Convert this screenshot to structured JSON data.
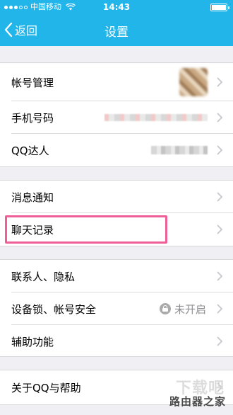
{
  "status_bar": {
    "carrier": "中国移动",
    "time": "14:43"
  },
  "nav": {
    "back_label": "返回",
    "title": "设置"
  },
  "groups": {
    "account": {
      "items": [
        {
          "label": "帐号管理"
        },
        {
          "label": "手机号码"
        },
        {
          "label": "QQ达人"
        }
      ]
    },
    "notify": {
      "items": [
        {
          "label": "消息通知"
        },
        {
          "label": "聊天记录"
        }
      ]
    },
    "privacy": {
      "items": [
        {
          "label": "联系人、隐私"
        },
        {
          "label": "设备锁、帐号安全",
          "status": "未开启"
        },
        {
          "label": "辅助功能"
        }
      ]
    },
    "about": {
      "items": [
        {
          "label": "关于QQ与帮助"
        }
      ]
    }
  },
  "watermark": {
    "top": "下载吧",
    "bottom": "路由器之家"
  },
  "colors": {
    "header": "#21b5ea",
    "background": "#efeff4",
    "highlight": "#ee5f97"
  }
}
